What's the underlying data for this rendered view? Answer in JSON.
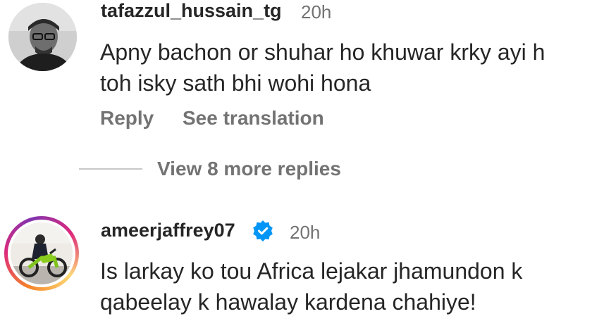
{
  "comments": [
    {
      "username": "tafazzul_hussain_tg",
      "time": "20h",
      "text_line1": "Apny bachon or shuhar ho khuwar krky ayi h",
      "text_line2": "toh isky sath bhi wohi hona",
      "reply_label": "Reply",
      "translation_label": "See translation",
      "view_replies_label": "View 8 more replies"
    },
    {
      "username": "ameerjaffrey07",
      "verified": true,
      "time": "20h",
      "text_line1": "Is larkay ko tou Africa lejakar jhamundon k",
      "text_line2": "qabeelay k hawalay kardena chahiye!"
    }
  ],
  "colors": {
    "username": "#262626",
    "secondary": "#737373",
    "verified_badge": "#0095f6",
    "story_ring_start": "#f58529",
    "story_ring_end": "#dd2a7b"
  }
}
